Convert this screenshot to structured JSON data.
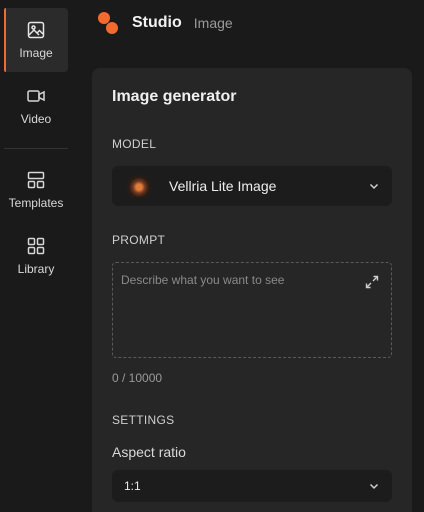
{
  "sidebar": {
    "items": [
      {
        "label": "Image",
        "icon": "image-icon",
        "active": true
      },
      {
        "label": "Video",
        "icon": "video-icon",
        "active": false
      },
      {
        "label": "Templates",
        "icon": "templates-icon",
        "active": false
      },
      {
        "label": "Library",
        "icon": "library-icon",
        "active": false
      }
    ]
  },
  "header": {
    "brand": "Studio",
    "section": "Image",
    "logo_icon": "studio-logo-icon",
    "accent_color": "#f26a2f"
  },
  "panel": {
    "title": "Image generator",
    "model": {
      "label": "MODEL",
      "selected": "Vellria Lite Image"
    },
    "prompt": {
      "label": "PROMPT",
      "placeholder": "Describe what you want to see",
      "value": "",
      "counter": "0 / 10000"
    },
    "settings": {
      "label": "SETTINGS",
      "aspect_ratio_label": "Aspect ratio",
      "aspect_ratio_value": "1:1"
    }
  }
}
